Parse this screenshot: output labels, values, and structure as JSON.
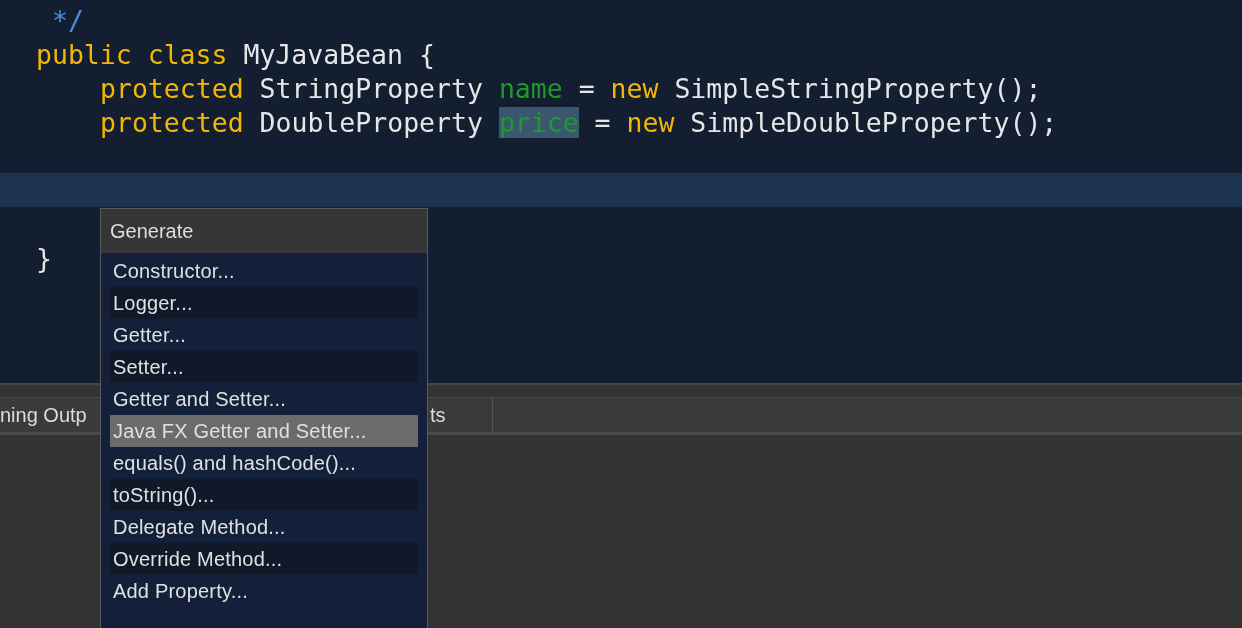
{
  "editor": {
    "lines": [
      {
        "current": false,
        "tokens": [
          {
            "kind": "comment",
            "text": " */"
          }
        ]
      },
      {
        "current": false,
        "tokens": [
          {
            "kind": "keyword",
            "text": "public class "
          },
          {
            "kind": "plain",
            "text": "MyJavaBean {"
          }
        ]
      },
      {
        "current": false,
        "indented": true,
        "tokens": [
          {
            "kind": "keyword",
            "text": "protected "
          },
          {
            "kind": "plain",
            "text": "StringProperty "
          },
          {
            "kind": "field",
            "text": "name",
            "selected": false
          },
          {
            "kind": "plain",
            "text": " = "
          },
          {
            "kind": "keyword",
            "text": "new "
          },
          {
            "kind": "plain",
            "text": "SimpleStringProperty();"
          }
        ]
      },
      {
        "current": false,
        "indented": true,
        "tokens": [
          {
            "kind": "keyword",
            "text": "protected "
          },
          {
            "kind": "plain",
            "text": "DoubleProperty "
          },
          {
            "kind": "field",
            "text": "price",
            "selected": true
          },
          {
            "kind": "plain",
            "text": " = "
          },
          {
            "kind": "keyword",
            "text": "new "
          },
          {
            "kind": "plain",
            "text": "SimpleDoubleProperty();"
          }
        ]
      },
      {
        "current": false
      },
      {
        "current": true
      },
      {
        "current": false
      },
      {
        "current": false,
        "tokens": [
          {
            "kind": "plain",
            "text": "}"
          }
        ]
      }
    ]
  },
  "output_tabs": [
    {
      "label": "ning Outp"
    },
    {
      "label": "ts"
    }
  ],
  "generate_menu": {
    "title": "Generate",
    "items": [
      {
        "label": "Constructor...",
        "selected": false
      },
      {
        "label": "Logger...",
        "selected": false
      },
      {
        "label": "Getter...",
        "selected": false
      },
      {
        "label": "Setter...",
        "selected": false
      },
      {
        "label": "Getter and Setter...",
        "selected": false
      },
      {
        "label": "Java FX Getter and Setter...",
        "selected": true
      },
      {
        "label": "equals() and hashCode()...",
        "selected": false
      },
      {
        "label": "toString()...",
        "selected": false
      },
      {
        "label": "Delegate Method...",
        "selected": false
      },
      {
        "label": "Override Method...",
        "selected": false
      },
      {
        "label": "Add Property...",
        "selected": false
      }
    ]
  }
}
